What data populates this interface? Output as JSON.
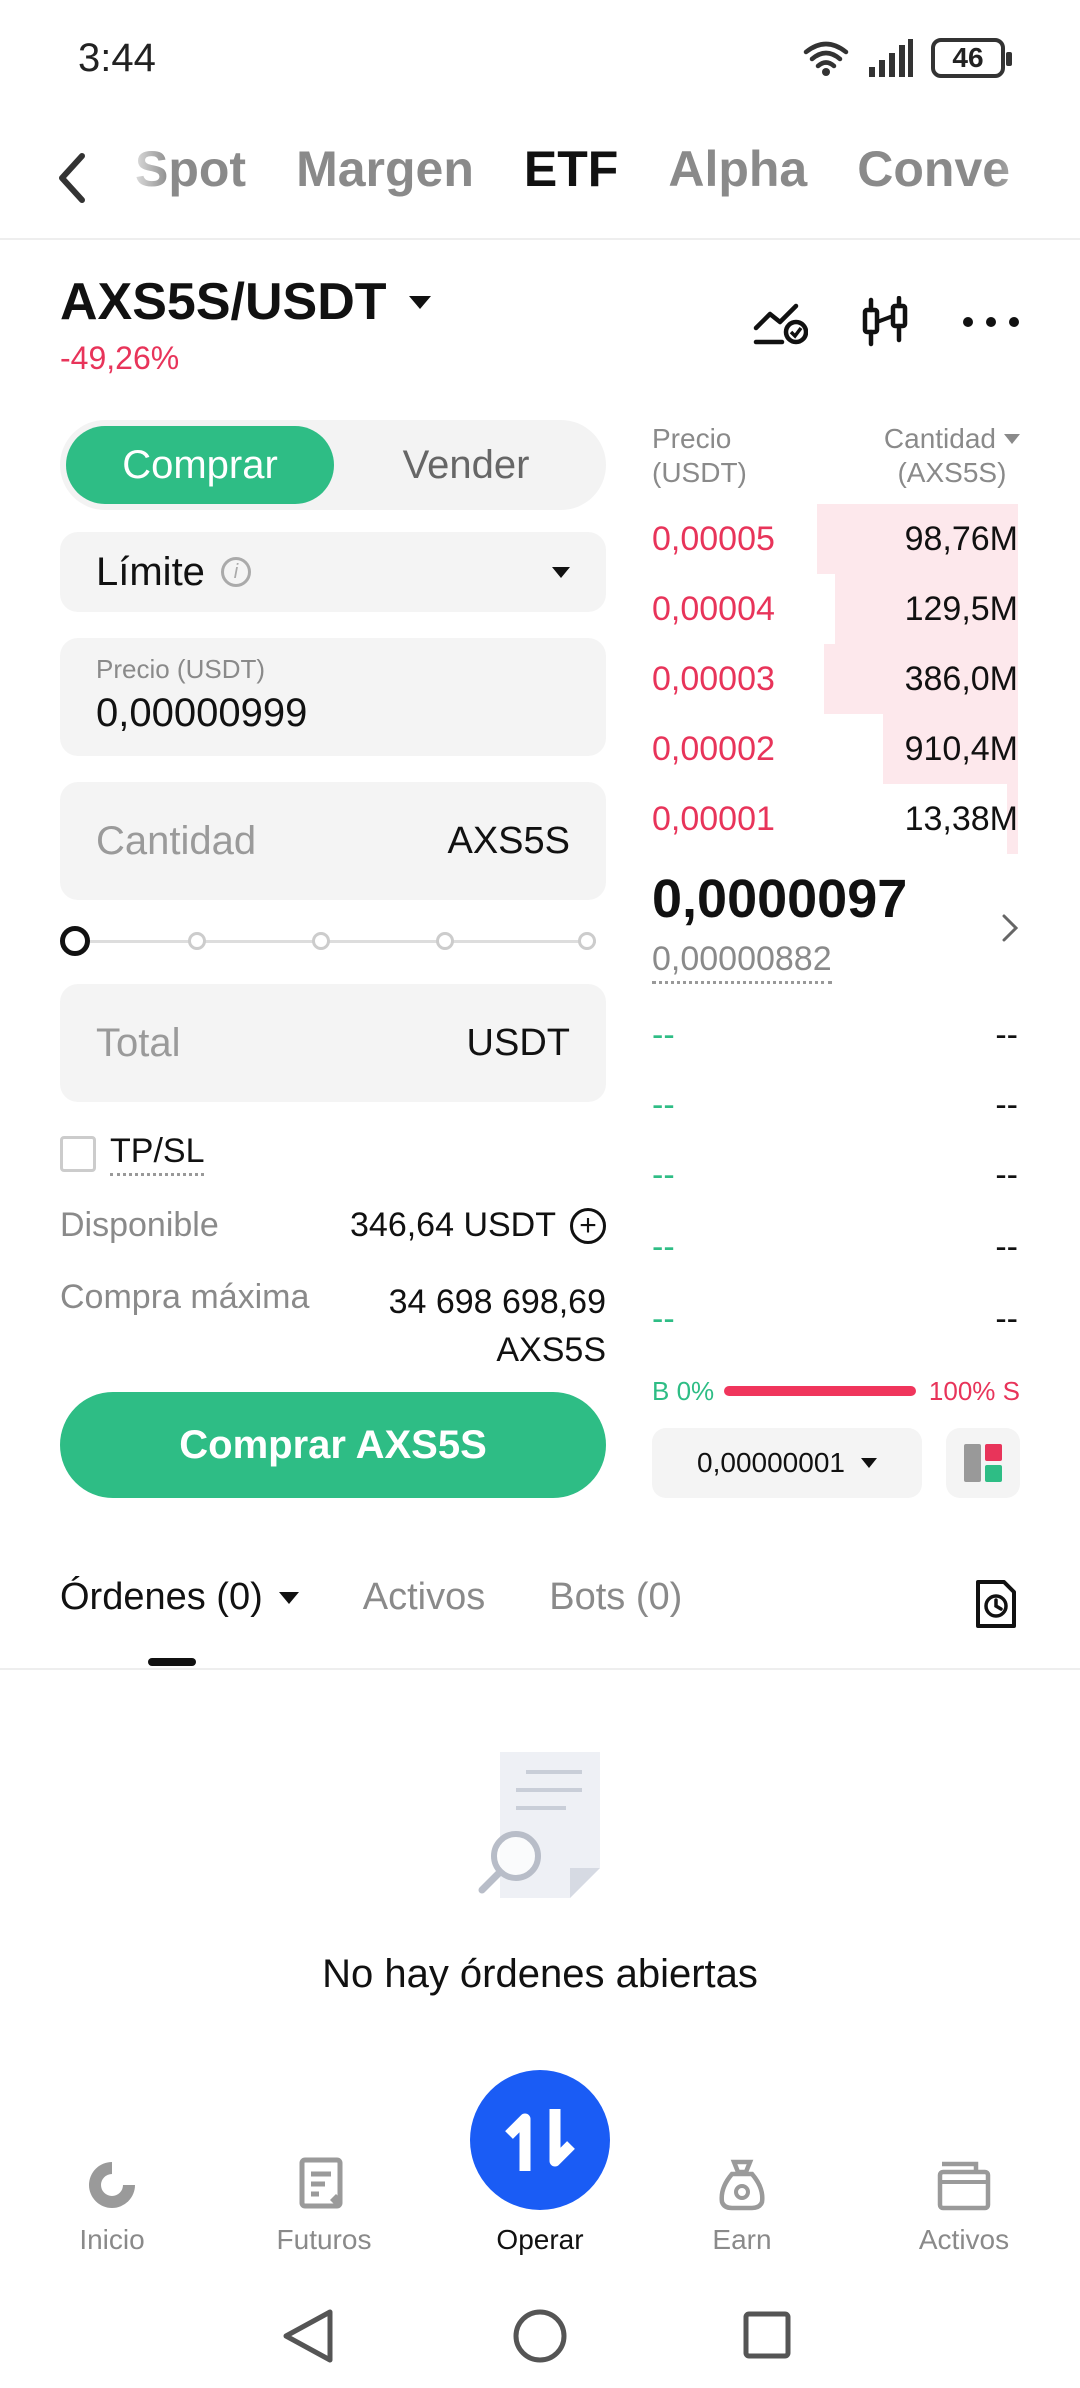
{
  "status": {
    "time": "3:44",
    "battery": "46"
  },
  "topnav": {
    "tabs": [
      {
        "label": "Spot",
        "active": false
      },
      {
        "label": "Margen",
        "active": false
      },
      {
        "label": "ETF",
        "active": true
      },
      {
        "label": "Alpha",
        "active": false
      },
      {
        "label": "Conve",
        "active": false
      }
    ]
  },
  "pair": {
    "symbol": "AXS5S/USDT",
    "change": "-49,26%"
  },
  "trade": {
    "buy_label": "Comprar",
    "sell_label": "Vender",
    "order_type": "Límite",
    "price_label": "Precio (USDT)",
    "price_value": "0,00000999",
    "qty_placeholder": "Cantidad",
    "qty_unit": "AXS5S",
    "total_placeholder": "Total",
    "total_unit": "USDT",
    "tpsl_label": "TP/SL",
    "available_label": "Disponible",
    "available_value": "346,64 USDT",
    "max_label": "Compra máxima",
    "max_value_line1": "34 698 698,69",
    "max_value_line2": "AXS5S",
    "submit_label": "Comprar AXS5S",
    "slider_percent": 0
  },
  "orderbook": {
    "price_header_1": "Precio",
    "price_header_2": "(USDT)",
    "qty_header_1": "Cantidad",
    "qty_header_2": "(AXS5S)",
    "asks": [
      {
        "price": "0,00005",
        "qty": "98,76M",
        "depth": 0.55
      },
      {
        "price": "0,00004",
        "qty": "129,5M",
        "depth": 0.5
      },
      {
        "price": "0,00003",
        "qty": "386,0M",
        "depth": 0.53
      },
      {
        "price": "0,00002",
        "qty": "910,4M",
        "depth": 0.37
      },
      {
        "price": "0,00001",
        "qty": "13,38M",
        "depth": 0.03
      }
    ],
    "last_price": "0,0000097",
    "mark_price": "0,00000882",
    "bids": [
      {
        "price": "--",
        "qty": "--"
      },
      {
        "price": "--",
        "qty": "--"
      },
      {
        "price": "--",
        "qty": "--"
      },
      {
        "price": "--",
        "qty": "--"
      },
      {
        "price": "--",
        "qty": "--"
      }
    ],
    "buy_ratio": "B 0%",
    "sell_ratio": "100% S",
    "precision": "0,00000001"
  },
  "orders": {
    "tabs": [
      {
        "label": "Órdenes (0)",
        "active": true
      },
      {
        "label": "Activos",
        "active": false
      },
      {
        "label": "Bots (0)",
        "active": false
      }
    ],
    "empty_text": "No hay órdenes abiertas"
  },
  "bottom_nav": [
    {
      "label": "Inicio",
      "icon": "home-icon"
    },
    {
      "label": "Futuros",
      "icon": "futures-icon"
    },
    {
      "label": "Operar",
      "icon": "trade-icon"
    },
    {
      "label": "Earn",
      "icon": "earn-icon"
    },
    {
      "label": "Activos",
      "icon": "wallet-icon"
    }
  ],
  "colors": {
    "green": "#2ebd85",
    "red": "#e8345a",
    "blue": "#1a5cf5"
  }
}
